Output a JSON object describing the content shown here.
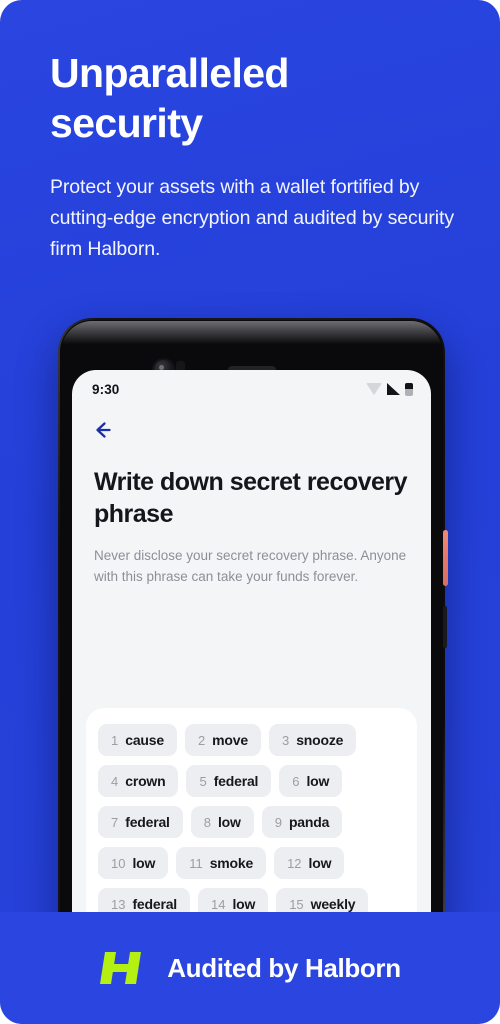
{
  "theme": {
    "background_blue": "#2440d8",
    "banner_blue": "#2a45e0",
    "accent_lime": "#b4f012",
    "back_arrow_blue": "#1b2fa8",
    "phone_screen_bg": "#f4f5f7",
    "chip_bg": "#eceef1",
    "power_button_color": "#e3786a"
  },
  "promo": {
    "headline_line1": "Unparalleled",
    "headline_line2": "security",
    "subcopy": "Protect your assets with a wallet fortified by cutting-edge encryption and audited by security firm Halborn."
  },
  "phone": {
    "status_bar": {
      "time": "9:30",
      "icons": [
        "wifi-icon",
        "cellular-signal-icon",
        "battery-icon"
      ]
    },
    "nav": {
      "back_label": "Back",
      "back_icon": "arrow-left-icon"
    },
    "app": {
      "title": "Write down secret recovery phrase",
      "description": "Never disclose your secret recovery phrase. Anyone with this phrase can take your funds forever.",
      "words": [
        {
          "index": "1",
          "word": "cause"
        },
        {
          "index": "2",
          "word": "move"
        },
        {
          "index": "3",
          "word": "snooze"
        },
        {
          "index": "4",
          "word": "crown"
        },
        {
          "index": "5",
          "word": "federal"
        },
        {
          "index": "6",
          "word": "low"
        },
        {
          "index": "7",
          "word": "federal"
        },
        {
          "index": "8",
          "word": "low"
        },
        {
          "index": "9",
          "word": "panda"
        },
        {
          "index": "10",
          "word": "low"
        },
        {
          "index": "11",
          "word": "smoke"
        },
        {
          "index": "12",
          "word": "low"
        },
        {
          "index": "13",
          "word": "federal"
        },
        {
          "index": "14",
          "word": "low"
        },
        {
          "index": "15",
          "word": "weekly"
        }
      ]
    }
  },
  "banner": {
    "logo_icon": "halborn-h-logo",
    "text": "Audited by Halborn"
  }
}
